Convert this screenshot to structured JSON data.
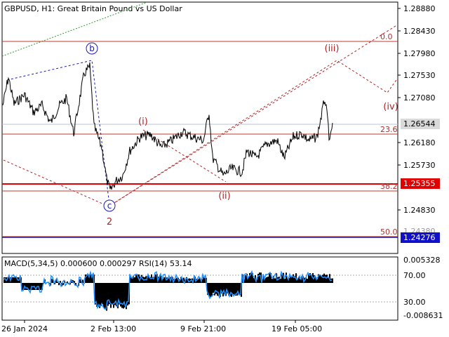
{
  "header": {
    "symbol_line": "GBPUSD, H1:  Great Britain Pound vs US Dollar"
  },
  "price_axis": {
    "labels": [
      "1.28880",
      "1.28430",
      "1.27980",
      "1.27530",
      "1.27080",
      "1.26180",
      "1.25730",
      "1.24830"
    ],
    "current_price": "1.26544",
    "level_red": "1.25355",
    "level_blue": "1.24276",
    "hidden_label": "1.24380"
  },
  "fib_levels": [
    {
      "label": "0.0",
      "price": 1.282
    },
    {
      "label": "23.6",
      "price": 1.2637
    },
    {
      "label": "38.2",
      "price": 1.2523
    },
    {
      "label": "50.0",
      "price": 1.243
    }
  ],
  "wave_labels": {
    "b": "b",
    "c": "c",
    "two": "2",
    "i": "(i)",
    "ii": "(ii)",
    "iii": "(iii)",
    "iv": "(iv)"
  },
  "indicator": {
    "header": "MACD(5,34,5) 0.000600 0.000297 RSI(14) 53.14",
    "axis_top": "0.005328",
    "axis_70": "70.00",
    "axis_30": "30.00",
    "axis_bottom": "-0.008631"
  },
  "time_axis": {
    "labels": [
      "26 Jan 2024",
      "2 Feb 13:00",
      "9 Feb 21:00",
      "19 Feb 05:00"
    ]
  },
  "colors": {
    "wave_red": "#b22222",
    "wave_blue": "#1a1ab4",
    "fib_line": "#c0392b",
    "trend_green": "#2e9b2e",
    "rsi_blue": "#1e90ff",
    "macd_black": "#000000",
    "current_price_bg": "#d9d9d9",
    "level_red_bg": "#e00000",
    "level_blue_bg": "#1010c8"
  },
  "chart_data": {
    "type": "line",
    "instrument": "GBPUSD",
    "timeframe": "H1",
    "series": [
      {
        "name": "GBPUSD",
        "x": [
          "26 Jan 2024",
          "2 Feb 13:00",
          "9 Feb 21:00",
          "19 Feb 05:00"
        ],
        "values": [
          1.2735,
          1.258,
          1.2635,
          1.2648
        ]
      }
    ],
    "ylim": [
      1.24,
      1.2895
    ]
  }
}
